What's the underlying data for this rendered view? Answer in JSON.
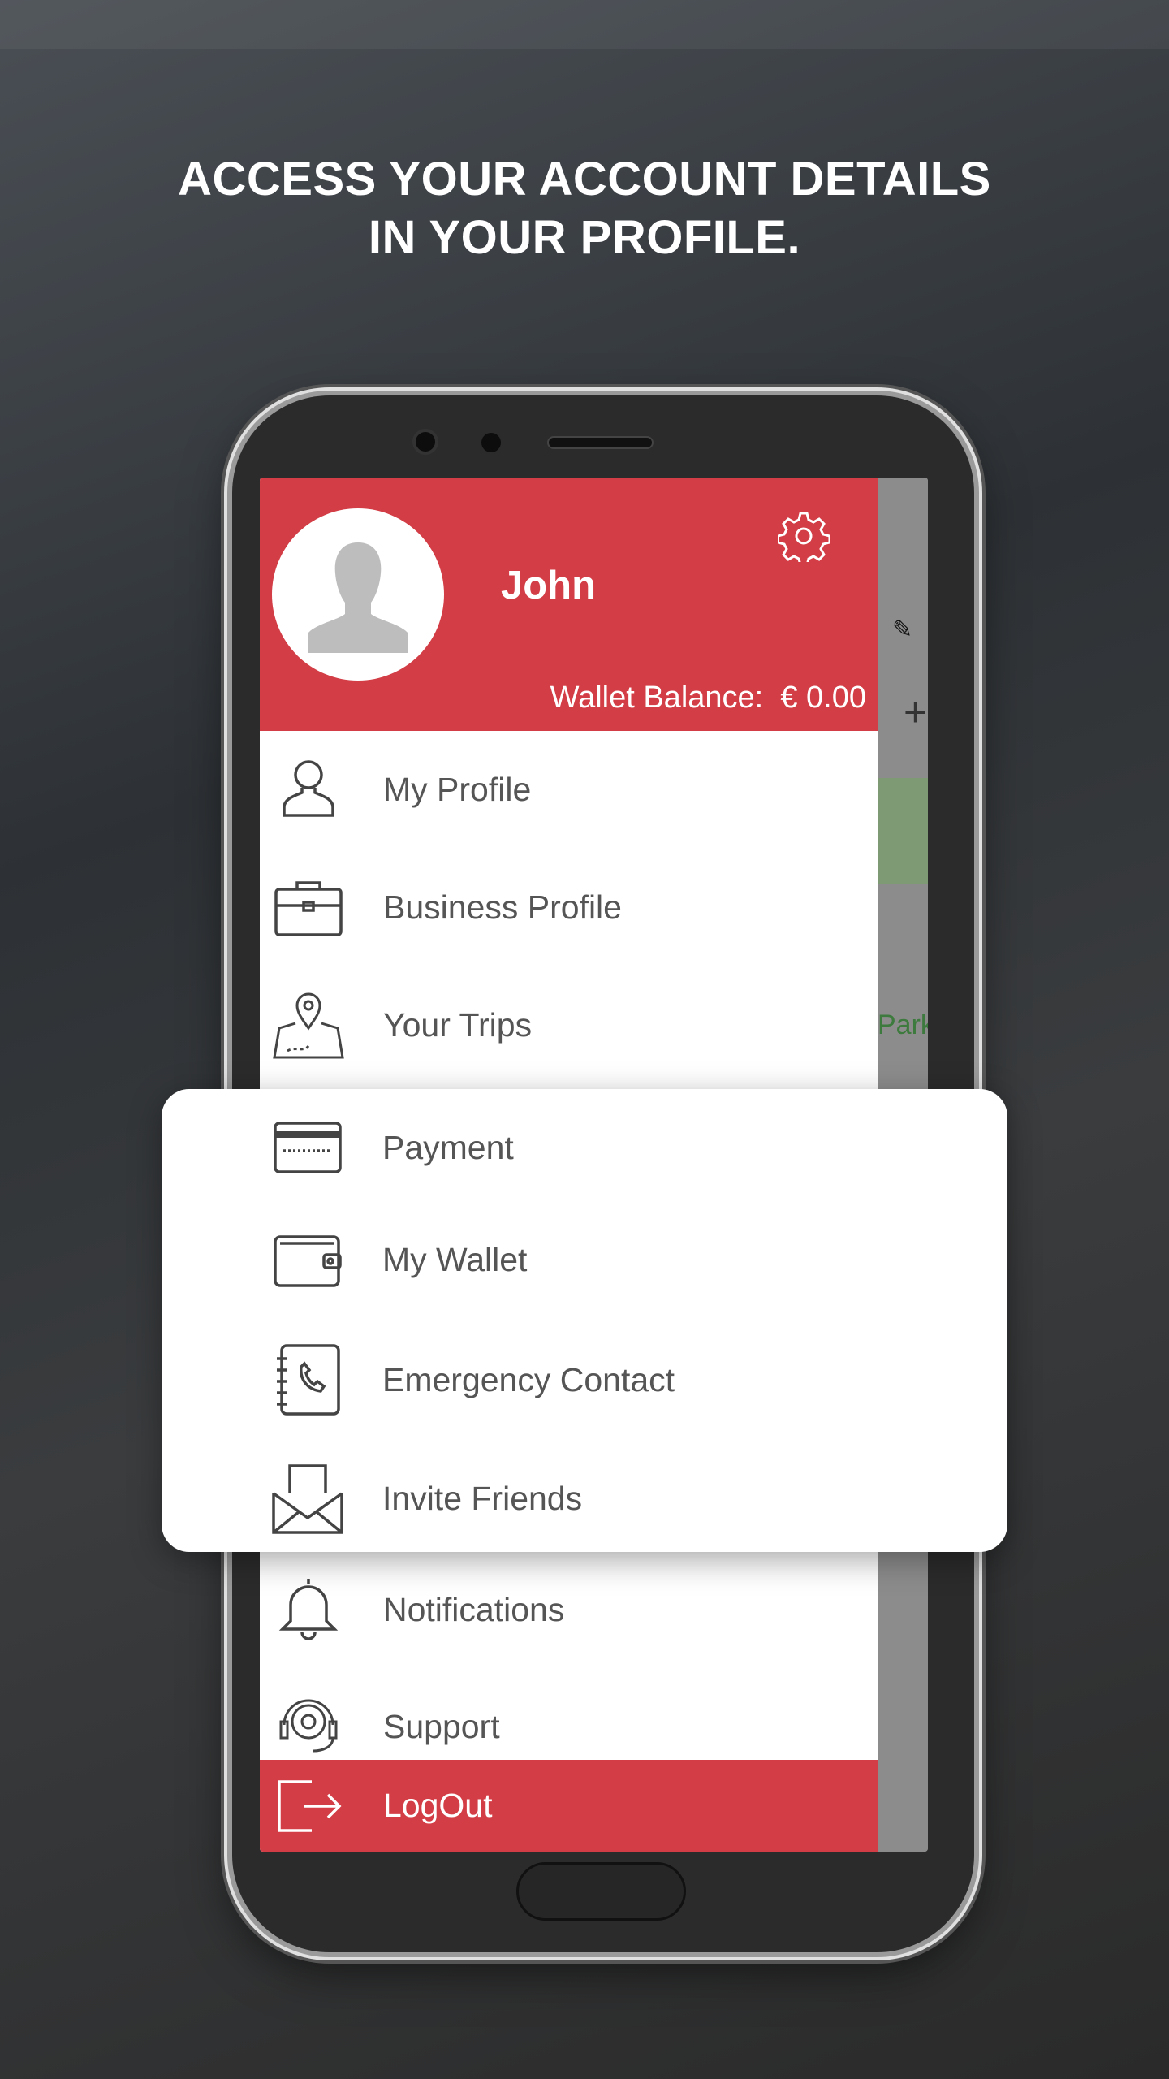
{
  "headline": {
    "line1": "ACCESS YOUR ACCOUNT DETAILS",
    "line2": "IN YOUR PROFILE."
  },
  "profile": {
    "name": "John",
    "wallet_label": "Wallet Balance:",
    "wallet_value": "€ 0.00"
  },
  "map": {
    "label": "Park"
  },
  "menu": [
    {
      "label": "My Profile",
      "icon": "person-icon"
    },
    {
      "label": "Business Profile",
      "icon": "briefcase-icon"
    },
    {
      "label": "Your Trips",
      "icon": "map-pin-icon"
    },
    {
      "label": "Payment",
      "icon": "credit-card-icon"
    },
    {
      "label": "My Wallet",
      "icon": "wallet-icon"
    },
    {
      "label": "Emergency Contact",
      "icon": "phone-book-icon"
    },
    {
      "label": "Invite Friends",
      "icon": "envelope-icon"
    },
    {
      "label": "Notifications",
      "icon": "bell-icon"
    },
    {
      "label": "Support",
      "icon": "support-gear-icon"
    }
  ],
  "logout": {
    "label": "LogOut",
    "icon": "logout-icon"
  },
  "colors": {
    "brand": "#d33d45",
    "text": "#555555"
  }
}
